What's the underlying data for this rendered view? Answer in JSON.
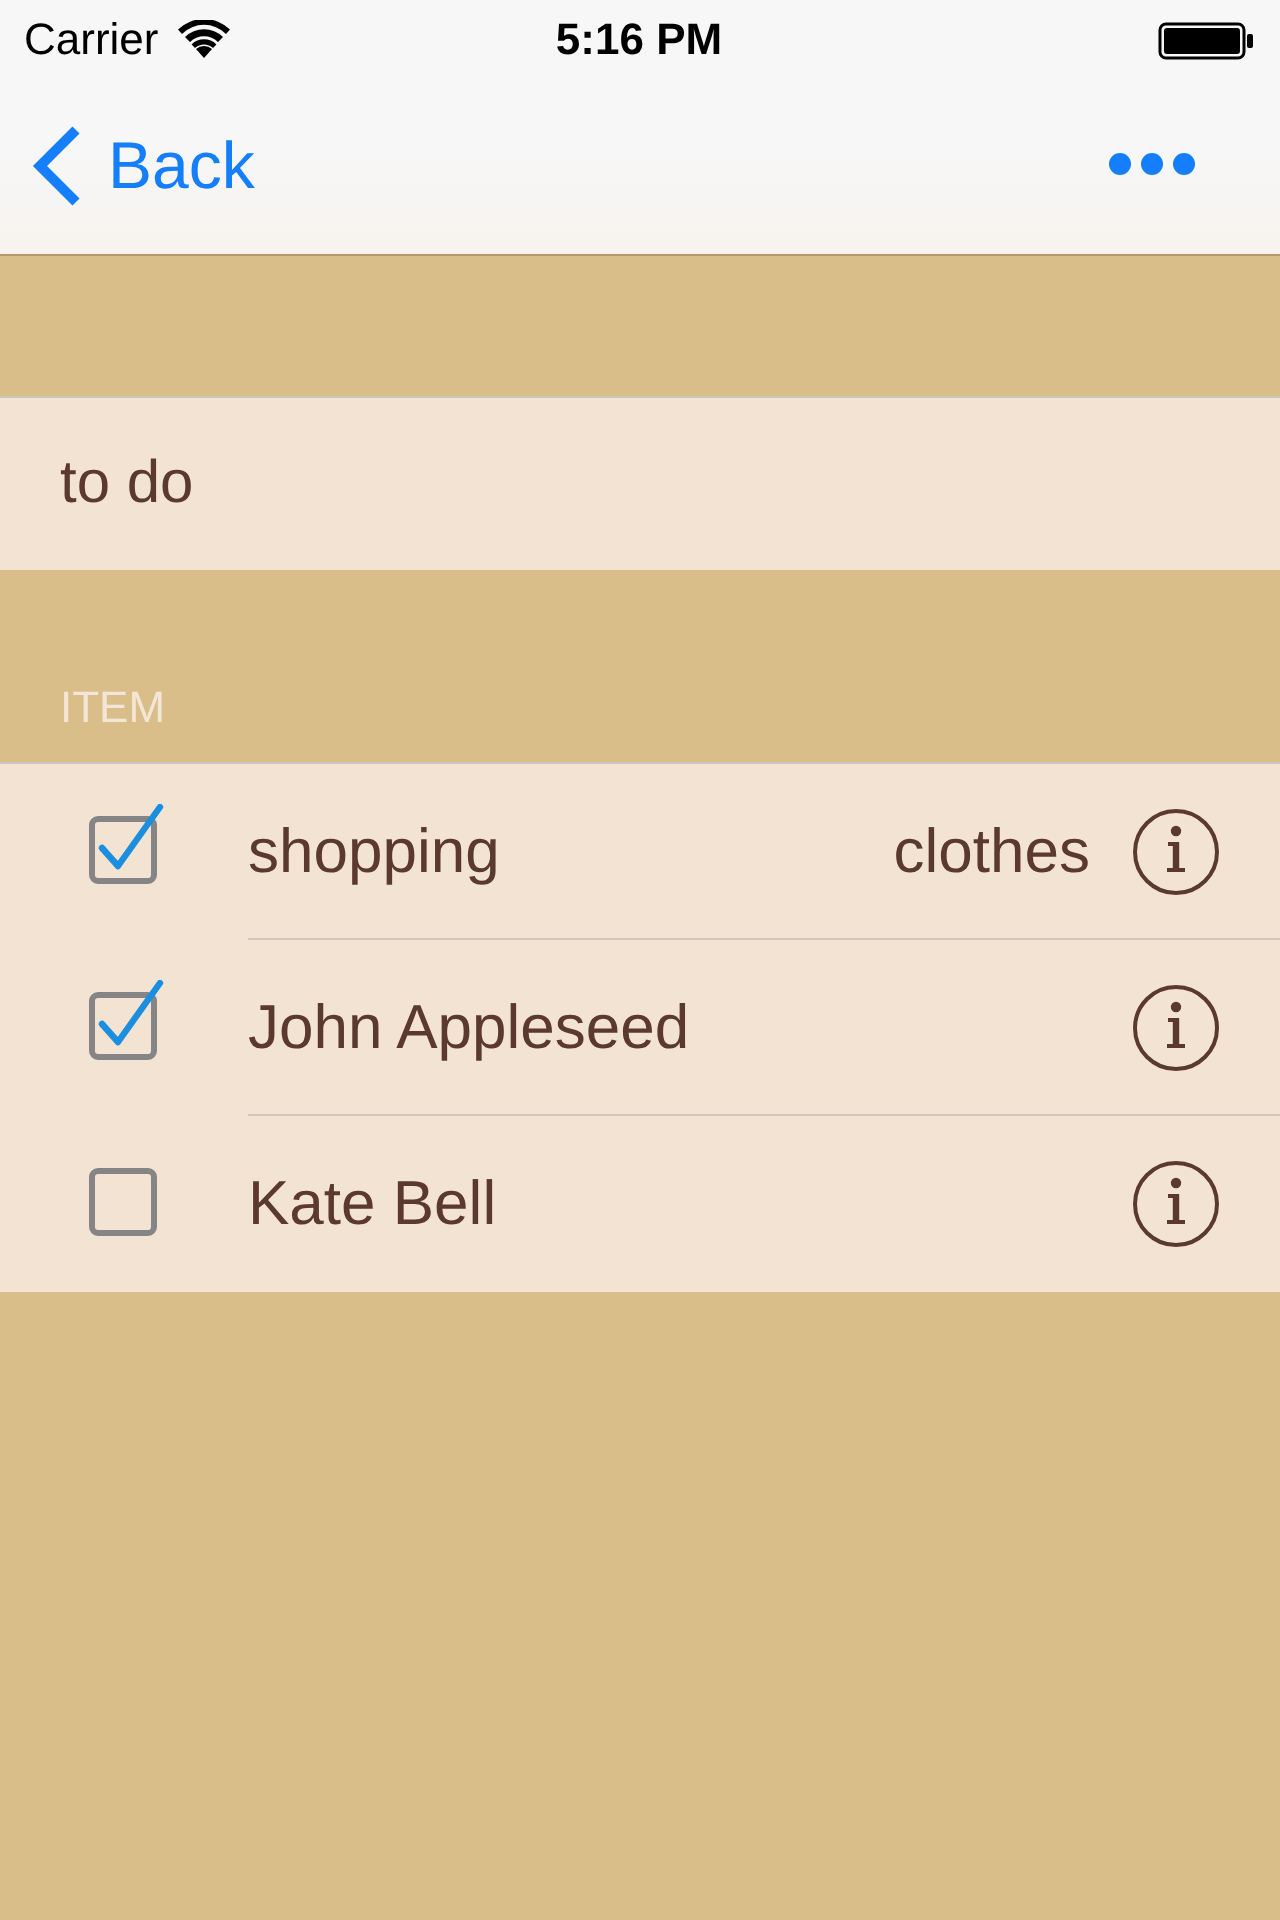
{
  "status_bar": {
    "carrier": "Carrier",
    "time": "5:16 PM"
  },
  "nav_bar": {
    "back": "Back"
  },
  "title_field": {
    "value": "to do"
  },
  "section": {
    "header": "ITEM",
    "items": [
      {
        "label": "shopping",
        "detail": "clothes",
        "checked": true
      },
      {
        "label": "John Appleseed",
        "checked": true
      },
      {
        "label": "Kate Bell",
        "checked": false
      }
    ]
  }
}
